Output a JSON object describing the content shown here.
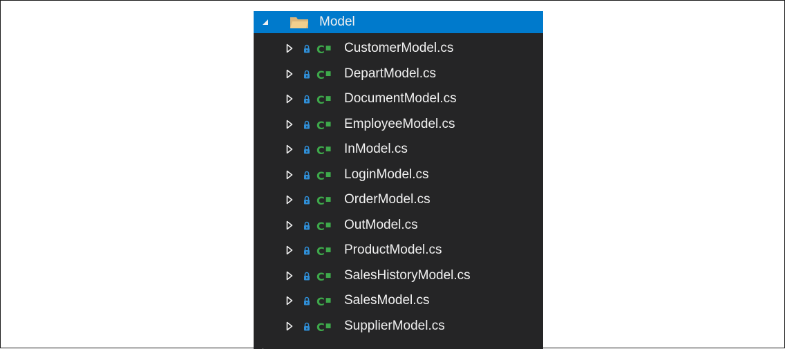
{
  "tree": {
    "folder": {
      "label": "Model",
      "icon": "folder-open-icon",
      "expanded": true,
      "selected": true,
      "selection_color": "#007acc"
    },
    "files": [
      {
        "label": "CustomerModel.cs"
      },
      {
        "label": "DepartModel.cs"
      },
      {
        "label": "DocumentModel.cs"
      },
      {
        "label": "EmployeeModel.cs"
      },
      {
        "label": "InModel.cs"
      },
      {
        "label": "LoginModel.cs"
      },
      {
        "label": "OrderModel.cs"
      },
      {
        "label": "OutModel.cs"
      },
      {
        "label": "ProductModel.cs"
      },
      {
        "label": "SalesHistoryModel.cs"
      },
      {
        "label": "SalesModel.cs"
      },
      {
        "label": "SupplierModel.cs"
      }
    ],
    "file_icon": "csharp-file-icon",
    "file_badge_icon": "lock-icon",
    "next_folder_icon": "folder-closed-icon",
    "colors": {
      "background": "#252526",
      "text": "#f1f1f1",
      "csharp_icon": "#3ea94b",
      "lock_icon": "#2f8fd8",
      "folder": "#dcb67a"
    }
  }
}
